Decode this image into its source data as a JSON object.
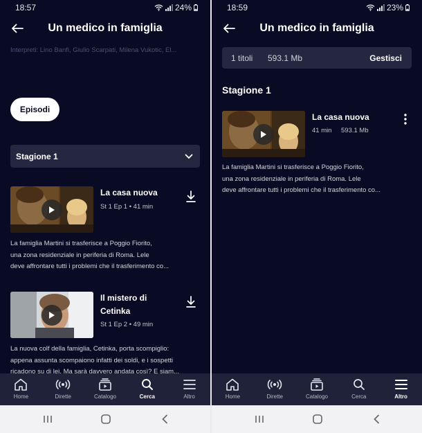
{
  "left": {
    "status": {
      "time": "18:57",
      "battery": "24%"
    },
    "header": {
      "title": "Un medico in famiglia"
    },
    "cast": "Interpreti: Lino Banfi, Giulio Scarpati, Milena Vukotic, El...",
    "episodes_button": "Episodi",
    "season_select": "Stagione 1",
    "episodes": [
      {
        "title": "La casa nuova",
        "meta": "St 1 Ep 1 • 41 min",
        "description": [
          "La famiglia Martini si trasferisce a Poggio Fiorito,",
          "una zona residenziale in periferia di Roma. Lele",
          "deve affrontare tutti i problemi che il trasferimento co..."
        ]
      },
      {
        "title_lines": [
          "Il mistero di",
          "Cetinka"
        ],
        "meta": "St 1 Ep 2 • 49 min",
        "description": [
          "La nuova colf della famiglia, Cetinka, porta scompiglio:",
          "appena assunta scompaiono infatti dei soldi, e i sospetti",
          "ricadono su di lei. Ma sarà davvero andata così? E siam..."
        ]
      }
    ],
    "nav": {
      "active": "Cerca",
      "items": [
        {
          "label": "Home",
          "icon": "home-icon"
        },
        {
          "label": "Dirette",
          "icon": "broadcast-icon"
        },
        {
          "label": "Catalogo",
          "icon": "catalog-icon"
        },
        {
          "label": "Cerca",
          "icon": "search-icon"
        },
        {
          "label": "Altro",
          "icon": "menu-icon"
        }
      ]
    }
  },
  "right": {
    "status": {
      "time": "18:59",
      "battery": "23%"
    },
    "header": {
      "title": "Un medico in famiglia"
    },
    "downloads": {
      "count": "1 titoli",
      "size": "593.1 Mb",
      "manage": "Gestisci"
    },
    "season_heading": "Stagione 1",
    "episode": {
      "title": "La casa nuova",
      "duration": "41 min",
      "size": "593.1 Mb",
      "description": [
        "La famiglia Martini si trasferisce a Poggio Fiorito,",
        "una zona residenziale in periferia di Roma. Lele",
        "deve affrontare tutti i problemi che il trasferimento co..."
      ]
    },
    "nav": {
      "active": "Altro",
      "items": [
        {
          "label": "Home",
          "icon": "home-icon"
        },
        {
          "label": "Dirette",
          "icon": "broadcast-icon"
        },
        {
          "label": "Catalogo",
          "icon": "catalog-icon"
        },
        {
          "label": "Cerca",
          "icon": "search-icon"
        },
        {
          "label": "Altro",
          "icon": "menu-icon"
        }
      ]
    }
  },
  "colors": {
    "background": "#090b24",
    "surface": "#24273f",
    "nav_bar": "#1f2238",
    "accent": "#ffffff"
  }
}
